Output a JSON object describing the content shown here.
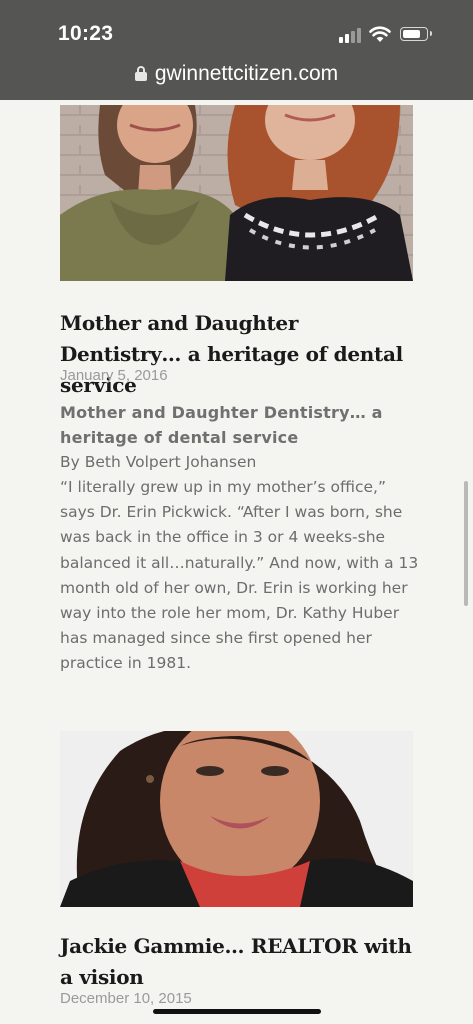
{
  "status_bar": {
    "time": "10:23"
  },
  "browser": {
    "url": "gwinnettcitizen.com"
  },
  "posts": [
    {
      "title": "Mother and Daughter Dentistry… a heritage of dental service",
      "date": "January 5, 2016",
      "excerpt_heading": "Mother and Daughter Dentistry… a heritage of dental service",
      "byline": "By Beth Volpert Johansen",
      "excerpt": "“I literally grew up in my mother’s office,” says Dr. Erin Pickwick. “After I was born, she was back in the office in 3 or 4 weeks-she balanced it all…naturally.” And now, with a 13 month old of her own, Dr. Erin is working her way into the role her mom, Dr. Kathy Huber has managed since she first opened her practice in 1981."
    },
    {
      "title": "Jackie Gammie… REALTOR with a vision",
      "date": "December 10, 2015"
    }
  ]
}
